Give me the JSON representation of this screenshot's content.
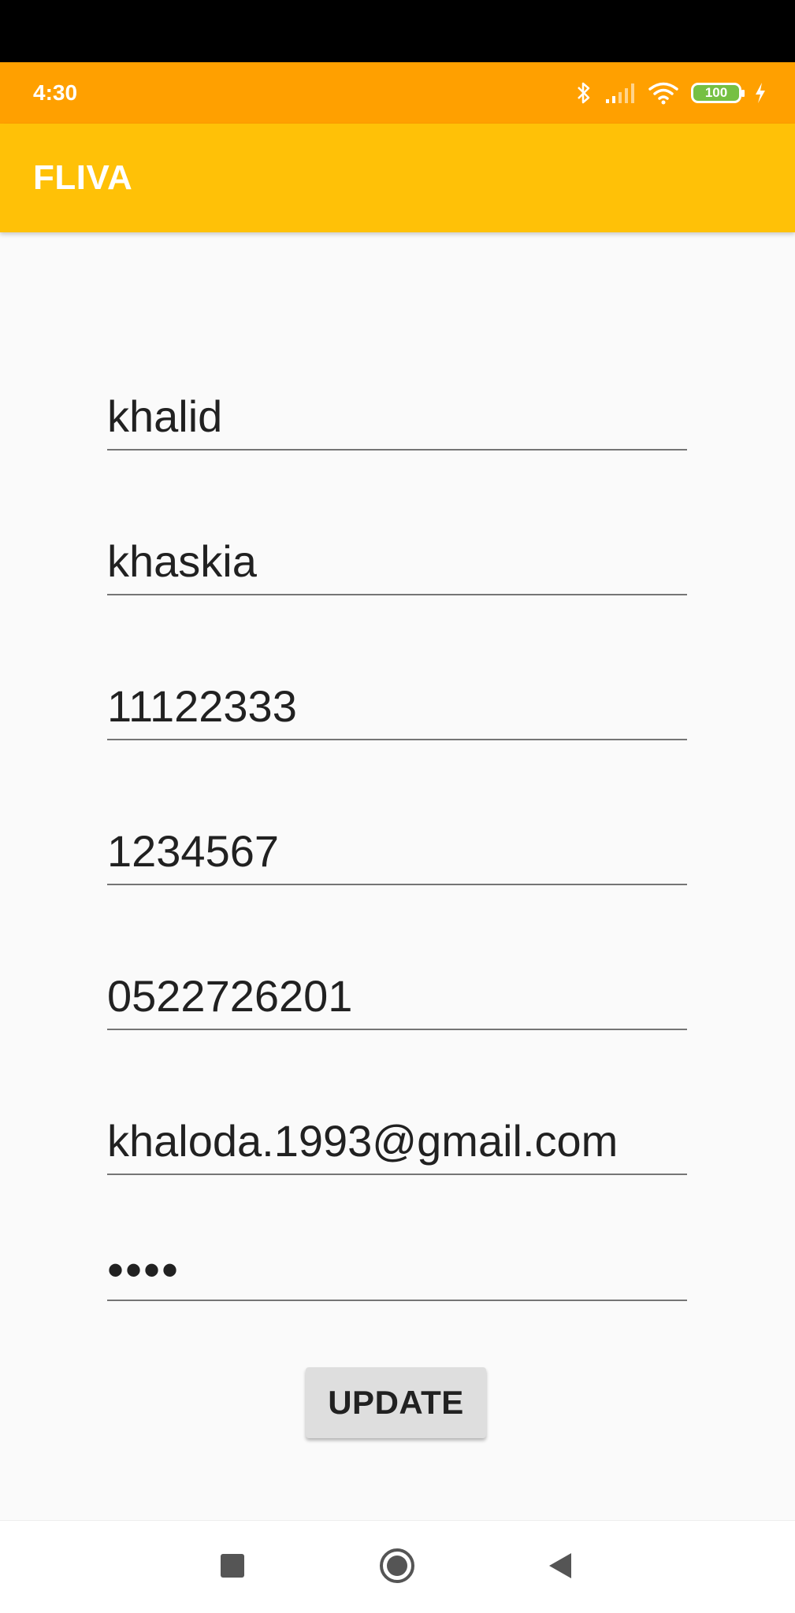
{
  "status_bar": {
    "time": "4:30",
    "battery_level": "100",
    "icons": [
      "bluetooth-icon",
      "signal-icon",
      "wifi-icon",
      "battery-icon",
      "charging-icon"
    ]
  },
  "app_bar": {
    "title": "FLIVA"
  },
  "form": {
    "first_name": "khalid",
    "last_name": "khaskia",
    "id_number": "11122333",
    "number": "1234567",
    "phone": "0522726201",
    "email": "khaloda.1993@gmail.com",
    "password_mask": "••••",
    "update_label": "UPDATE"
  },
  "nav_bar": {
    "buttons": [
      "recents-icon",
      "home-icon",
      "back-icon"
    ]
  },
  "colors": {
    "status_bar": "#ffa000",
    "app_bar": "#ffc107",
    "background": "#fafafa",
    "button": "#dedede"
  }
}
